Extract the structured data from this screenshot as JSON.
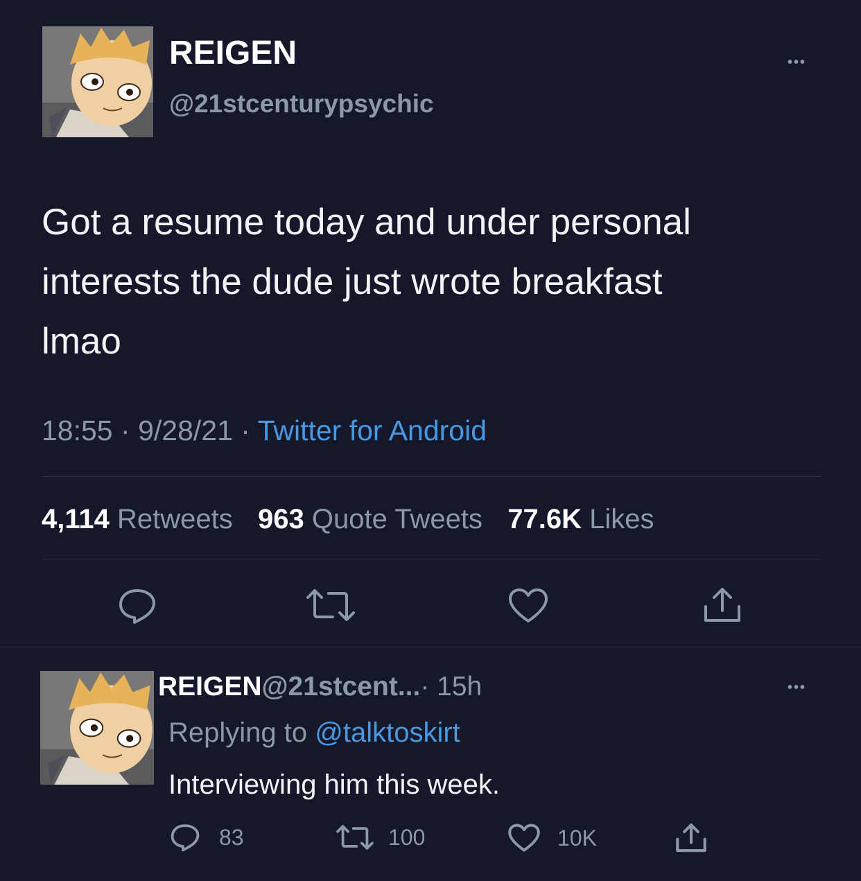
{
  "main_tweet": {
    "display_name": "REIGEN",
    "handle": "@21stcenturypsychic",
    "text_lines": [
      "Got a resume today and under personal",
      "interests the dude just wrote breakfast",
      "lmao"
    ],
    "time": "18:55",
    "separator": "·",
    "date": "9/28/21",
    "source": "Twitter for Android",
    "stats": {
      "retweets_count": "4,114",
      "retweets_label": "Retweets",
      "quotes_count": "963",
      "quotes_label": "Quote Tweets",
      "likes_count": "77.6K",
      "likes_label": "Likes"
    },
    "more_label": "•••"
  },
  "reply": {
    "display_name": "REIGEN",
    "handle": "@21stcent...",
    "separator": "·",
    "time_ago": "15h",
    "replying_to_label": "Replying to",
    "replying_to_handle": "@talktoskirt",
    "text": "Interviewing him this week.",
    "reply_count": "83",
    "retweet_count": "100",
    "like_count": "10K",
    "more_label": "•••"
  },
  "icons": {
    "reply": "speech-bubble-icon",
    "retweet": "retweet-arrows-icon",
    "like": "heart-icon",
    "share": "share-upload-icon",
    "more": "ellipsis-icon"
  },
  "colors": {
    "background": "#15182a",
    "link": "#4a98e0",
    "muted": "#8b98a5",
    "divider": "#2c3140"
  }
}
